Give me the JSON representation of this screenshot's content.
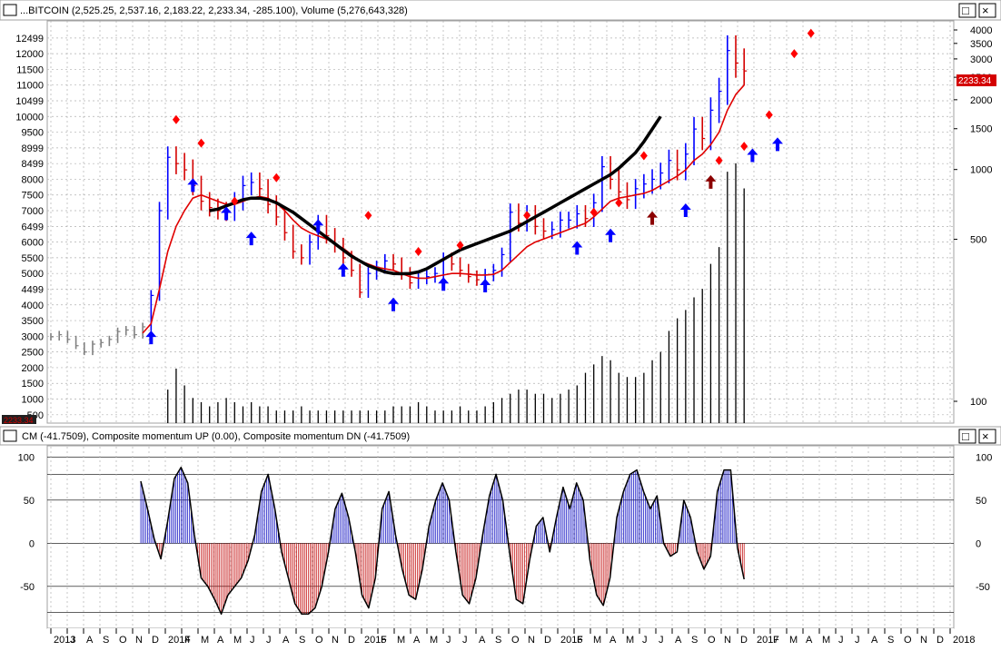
{
  "window": {
    "price_title": "...BITCOIN (2,525.25, 2,537.16, 2,183.22, 2,233.34, -285.100), Volume (5,276,643,328)",
    "cm_title": "CM (-41.7509), Composite momentum UP (0.00), Composite momentum DN (-41.7509)",
    "price_button_label": "□",
    "close_button_label": "×",
    "last_price_label": "2233.34",
    "left_corner_label": "2233.34"
  },
  "colors": {
    "price_up": "#0000ff",
    "price_down": "#d40000",
    "price_pre": "#808080",
    "ma_fast": "#e00000",
    "ma_slow": "#000000",
    "volume": "#000000",
    "cm_line": "#000000",
    "cm_up": "#0000c0",
    "cm_down": "#c00000",
    "marker_sell": "#ff0000",
    "marker_buy": "#0000ff",
    "marker_buy_dark": "#8b0000"
  },
  "chart_data": [
    {
      "type": "line",
      "title": "...BITCOIN (2,525.25, 2,537.16, 2,183.22, 2,233.34, -285.100), Volume (5,276,643,328)",
      "left_ticks": [
        500,
        1000,
        1500,
        2000,
        2500,
        3000,
        3500,
        4000,
        4499,
        5000,
        5500,
        6000,
        6499,
        7000,
        7500,
        8000,
        8499,
        8999,
        9500,
        10000,
        10499,
        11000,
        11500,
        12000,
        12499
      ],
      "right_ticks": [
        100,
        500,
        1000,
        1500,
        2000,
        2500,
        3000,
        3500,
        4000
      ],
      "x_axis": [
        "2013",
        "J",
        "A",
        "S",
        "O",
        "N",
        "D",
        "2014",
        "F",
        "M",
        "A",
        "M",
        "J",
        "J",
        "A",
        "S",
        "O",
        "N",
        "D",
        "2015",
        "F",
        "M",
        "A",
        "M",
        "J",
        "J",
        "A",
        "S",
        "O",
        "N",
        "D",
        "2016",
        "F",
        "M",
        "A",
        "M",
        "J",
        "J",
        "A",
        "S",
        "O",
        "N",
        "D",
        "2017",
        "F",
        "M",
        "A",
        "M",
        "J",
        "J",
        "A",
        "S",
        "O",
        "N",
        "D",
        "2018"
      ],
      "last_value": 2233.34,
      "price_series": [
        {
          "name": "price",
          "values": [
            2983,
            3050,
            2900,
            2700,
            2500,
            2750,
            2800,
            2900,
            3150,
            3200,
            3050,
            3300,
            4300,
            7000,
            8700,
            8500,
            8300,
            7800,
            7300,
            7100,
            7000,
            6950,
            7300,
            7800,
            7900,
            7700,
            7200,
            6800,
            6300,
            5700,
            5500,
            6000,
            6600,
            6200,
            5900,
            5500,
            5100,
            4400,
            5000,
            5200,
            5400,
            5300,
            5000,
            4700,
            4850,
            4900,
            5000,
            5450,
            5300,
            5100,
            4900,
            4800,
            4950,
            5100,
            5600,
            6950,
            6600,
            6900,
            6500,
            6350,
            6400,
            6700,
            6700,
            6900,
            6750,
            7250,
            8400,
            8000,
            7600,
            7350,
            7700,
            7850,
            8000,
            8200,
            8600,
            8300,
            8800,
            9600,
            9300,
            10200,
            10800,
            12100,
            11700,
            11450
          ]
        },
        {
          "name": "ma_fast",
          "values": [
            null,
            null,
            null,
            null,
            null,
            null,
            null,
            null,
            null,
            null,
            null,
            3100,
            3400,
            4500,
            5700,
            6500,
            7000,
            7400,
            7500,
            7400,
            7300,
            7200,
            7200,
            7300,
            7400,
            7450,
            7400,
            7250,
            7000,
            6700,
            6450,
            6300,
            6200,
            6100,
            5950,
            5800,
            5600,
            5400,
            5300,
            5200,
            5150,
            5100,
            5000,
            4900,
            4850,
            4850,
            4900,
            4950,
            5000,
            5000,
            4980,
            4950,
            4950,
            4970,
            5100,
            5350,
            5600,
            5850,
            6000,
            6100,
            6200,
            6300,
            6400,
            6500,
            6600,
            6800,
            7050,
            7300,
            7400,
            7450,
            7500,
            7550,
            7650,
            7800,
            7950,
            8100,
            8300,
            8600,
            8800,
            9100,
            9500,
            10200,
            10700,
            11000
          ]
        },
        {
          "name": "ma_slow",
          "values": [
            null,
            null,
            null,
            null,
            null,
            null,
            null,
            null,
            null,
            null,
            null,
            null,
            null,
            null,
            null,
            null,
            null,
            null,
            null,
            7000,
            7050,
            7150,
            7250,
            7350,
            7400,
            7400,
            7350,
            7250,
            7100,
            6950,
            6750,
            6550,
            6350,
            6150,
            5950,
            5750,
            5550,
            5400,
            5250,
            5150,
            5050,
            5000,
            4990,
            5000,
            5050,
            5150,
            5300,
            5450,
            5600,
            5750,
            5850,
            5950,
            6050,
            6150,
            6250,
            6350,
            6500,
            6650,
            6800,
            6950,
            7100,
            7250,
            7400,
            7550,
            7700,
            7850,
            8000,
            8150,
            8350,
            8600,
            8850,
            9200,
            9600,
            10000
          ]
        }
      ],
      "volume_values": [
        0,
        0,
        0,
        0,
        0,
        0,
        0,
        0,
        0,
        0,
        0,
        0,
        0,
        0,
        80,
        130,
        90,
        60,
        50,
        40,
        50,
        60,
        50,
        40,
        50,
        40,
        40,
        30,
        30,
        30,
        40,
        30,
        30,
        30,
        30,
        30,
        30,
        30,
        30,
        30,
        30,
        40,
        40,
        40,
        50,
        40,
        30,
        30,
        30,
        40,
        30,
        30,
        40,
        50,
        60,
        70,
        80,
        80,
        70,
        70,
        60,
        70,
        80,
        90,
        120,
        140,
        160,
        150,
        120,
        110,
        110,
        120,
        150,
        170,
        220,
        250,
        270,
        300,
        320,
        380,
        420,
        600,
        620,
        560
      ],
      "sell_markers": [
        {
          "i": 15,
          "v": 9900
        },
        {
          "i": 18,
          "v": 9150
        },
        {
          "i": 22,
          "v": 7300
        },
        {
          "i": 27,
          "v": 8050
        },
        {
          "i": 38,
          "v": 6850
        },
        {
          "i": 44,
          "v": 5700
        },
        {
          "i": 49,
          "v": 5900
        },
        {
          "i": 57,
          "v": 6850
        },
        {
          "i": 65,
          "v": 6950
        },
        {
          "i": 68,
          "v": 7250
        },
        {
          "i": 71,
          "v": 8750
        },
        {
          "i": 80,
          "v": 8600
        },
        {
          "i": 83,
          "v": 9050
        },
        {
          "i": 86,
          "v": 10050
        },
        {
          "i": 89,
          "v": 12000
        },
        {
          "i": 91,
          "v": 12650
        }
      ],
      "buy_markers": [
        {
          "i": 12,
          "v": 2950,
          "dark": false
        },
        {
          "i": 17,
          "v": 7800,
          "dark": false
        },
        {
          "i": 21,
          "v": 6900,
          "dark": false
        },
        {
          "i": 24,
          "v": 6100,
          "dark": false
        },
        {
          "i": 32,
          "v": 6500,
          "dark": false
        },
        {
          "i": 35,
          "v": 5100,
          "dark": false
        },
        {
          "i": 41,
          "v": 4000,
          "dark": false
        },
        {
          "i": 47,
          "v": 4650,
          "dark": false
        },
        {
          "i": 52,
          "v": 4600,
          "dark": false
        },
        {
          "i": 63,
          "v": 5800,
          "dark": false
        },
        {
          "i": 67,
          "v": 6200,
          "dark": false
        },
        {
          "i": 72,
          "v": 6750,
          "dark": true
        },
        {
          "i": 76,
          "v": 7000,
          "dark": false
        },
        {
          "i": 79,
          "v": 7900,
          "dark": true
        },
        {
          "i": 84,
          "v": 8750,
          "dark": false
        },
        {
          "i": 87,
          "v": 9100,
          "dark": false
        }
      ]
    },
    {
      "type": "area",
      "title": "CM (-41.7509), Composite momentum UP (0.00), Composite momentum DN (-41.7509)",
      "y_ticks": [
        100,
        50,
        0,
        -50
      ],
      "last_value": -41.7509,
      "values": [
        72,
        40,
        5,
        -18,
        25,
        75,
        88,
        70,
        10,
        -40,
        -50,
        -65,
        -82,
        -60,
        -50,
        -40,
        -20,
        10,
        60,
        80,
        40,
        -10,
        -40,
        -70,
        -82,
        -82,
        -75,
        -50,
        -10,
        40,
        58,
        30,
        -10,
        -60,
        -75,
        -40,
        40,
        60,
        10,
        -30,
        -60,
        -65,
        -30,
        20,
        50,
        70,
        50,
        -10,
        -60,
        -70,
        -40,
        10,
        55,
        80,
        50,
        -10,
        -65,
        -70,
        -20,
        20,
        30,
        -10,
        30,
        65,
        40,
        70,
        50,
        -20,
        -60,
        -72,
        -40,
        30,
        60,
        80,
        85,
        60,
        40,
        55,
        0,
        -15,
        -10,
        50,
        30,
        -10,
        -30,
        -15,
        60,
        85,
        85,
        -5,
        -41.75
      ]
    }
  ]
}
